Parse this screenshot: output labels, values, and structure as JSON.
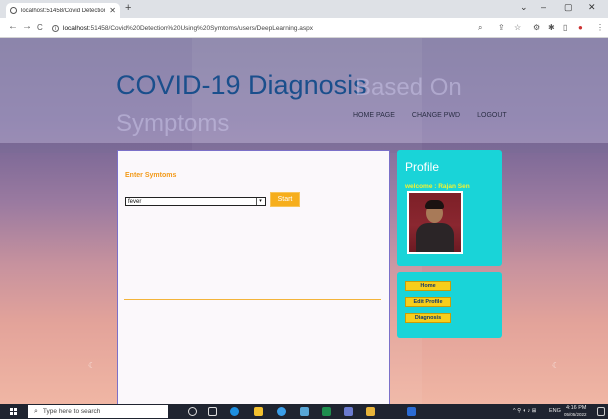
{
  "browser": {
    "tab_title": "localhost:51458/Covid Detection",
    "tab_close": "✕",
    "new_tab": "+",
    "window_controls": [
      "⌄",
      "–",
      "▢",
      "✕"
    ],
    "nav": {
      "back": "←",
      "forward": "→",
      "reload": "C"
    },
    "url_host": "localhost",
    "url_path": ":51458/Covid%20Detection%20Using%20Symtoms/users/DeepLearning.aspx",
    "extension_icons": [
      "search-icon",
      "share-icon",
      "star-icon",
      "puzzle-icon",
      "pin-icon",
      "sidebar-icon",
      "profile-icon",
      "menu-icon"
    ]
  },
  "site": {
    "title": "COVID-19 Diagnosis",
    "title_ghost_1": "Based On",
    "title_ghost_2": "Symptoms",
    "nav": [
      {
        "label": "HOME PAGE"
      },
      {
        "label": "CHANGE PWD"
      },
      {
        "label": "LOGOUT"
      }
    ]
  },
  "main": {
    "section_label": "Enter Symtoms",
    "symptom_select_value": "fever",
    "start_button": "Start"
  },
  "profile": {
    "title": "Profile",
    "welcome": "welcome : Rajan Sen"
  },
  "menu": {
    "items": [
      {
        "label": "Home"
      },
      {
        "label": "Edit Profile"
      },
      {
        "label": "Diagnosis"
      }
    ]
  },
  "taskbar": {
    "search_placeholder": "Type here to search",
    "tray_lang": "ENG",
    "tray_time": "4:16 PM",
    "tray_date": "05/05/2022"
  },
  "colors": {
    "title_blue": "#1a4f8c",
    "accent_orange": "#f6ae1c",
    "panel_cyan": "#19d4d8",
    "menu_yellow": "#f7ce1a",
    "welcome_yellow": "#f2f230"
  }
}
